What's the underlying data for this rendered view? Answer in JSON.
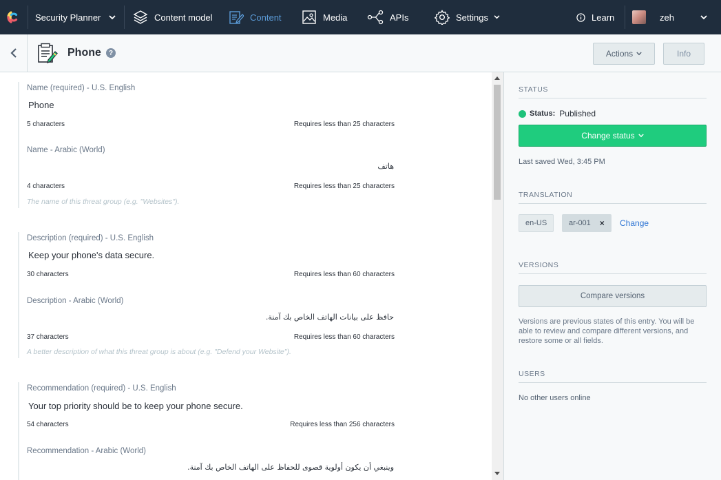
{
  "topnav": {
    "space_name": "Security Planner",
    "content_model": "Content model",
    "content": "Content",
    "media": "Media",
    "apis": "APIs",
    "settings": "Settings",
    "learn": "Learn",
    "user": "zeh",
    "accent_color": "#5b9bd8"
  },
  "header": {
    "title": "Phone",
    "help": "?",
    "actions_label": "Actions",
    "info_label": "Info"
  },
  "fields": [
    {
      "en_label": "Name (required) - U.S. English",
      "en_value": "Phone",
      "en_count": "5 characters",
      "limit": "Requires less than 25 characters",
      "ar_label": "Name - Arabic (World)",
      "ar_value": "هاتف",
      "ar_count": "4 characters",
      "hint": "The name of this threat group (e.g. \"Websites\")."
    },
    {
      "en_label": "Description (required) - U.S. English",
      "en_value": "Keep your phone's data secure.",
      "en_count": "30 characters",
      "limit": "Requires less than 60 characters",
      "ar_label": "Description - Arabic (World)",
      "ar_value": "حافظ على بيانات الهاتف الخاص بك آمنة.",
      "ar_count": "37 characters",
      "hint": "A better description of what this threat group is about (e.g. \"Defend your Website\")."
    },
    {
      "en_label": "Recommendation (required) - U.S. English",
      "en_value": "Your top priority should be to keep your phone secure.",
      "en_count": "54 characters",
      "limit": "Requires less than 256 characters",
      "ar_label": "Recommendation - Arabic (World)",
      "ar_value": "وينبغي أن يكون أولوية قصوى للحفاظ على الهاتف الخاص بك آمنة."
    }
  ],
  "sidebar": {
    "status_title": "STATUS",
    "status_label": "Status:",
    "status_value": "Published",
    "status_color": "#1fcc7e",
    "change_status": "Change status",
    "last_saved": "Last saved Wed, 3:45 PM",
    "translation_title": "TRANSLATION",
    "locales": [
      "en-US",
      "ar-001"
    ],
    "remove_icon": "×",
    "change_link": "Change",
    "versions_title": "VERSIONS",
    "compare_versions": "Compare versions",
    "versions_text": "Versions are previous states of this entry. You will be able to review and compare different versions, and restore some or all fields.",
    "users_title": "USERS",
    "users_text": "No other users online"
  }
}
